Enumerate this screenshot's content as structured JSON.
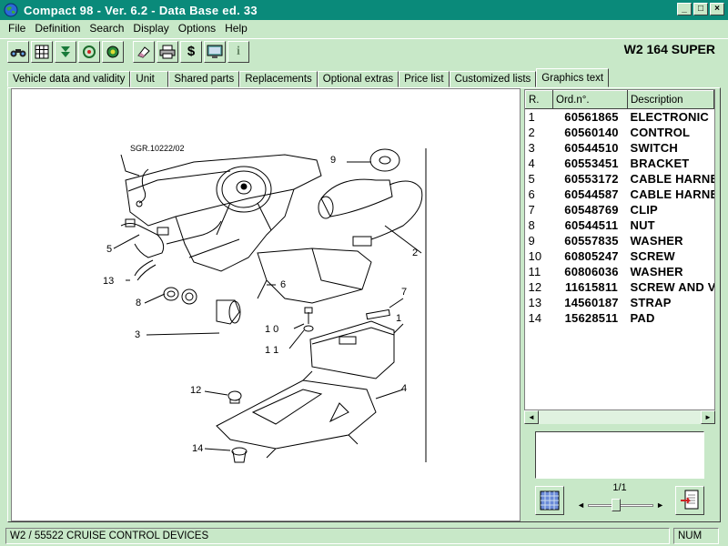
{
  "window": {
    "title": "Compact 98  -  Ver. 6.2  -  Data Base ed. 33",
    "minimize_glyph": "_",
    "maximize_glyph": "□",
    "close_glyph": "×"
  },
  "menu": [
    "File",
    "Definition",
    "Search",
    "Display",
    "Options",
    "Help"
  ],
  "toolbar": {
    "icons": [
      "binoculars-icon",
      "grid-icon",
      "down-arrow-icon",
      "steering-wheel-icon",
      "power-icon",
      "eraser-icon",
      "printer-icon",
      "dollar-icon",
      "monitor-icon",
      "info-icon"
    ],
    "dollar_glyph": "$",
    "info_glyph": "i"
  },
  "model": "W2 164 SUPER",
  "tabs": [
    {
      "label": "Vehicle data and validity",
      "active": false
    },
    {
      "label": "Unit",
      "active": false
    },
    {
      "label": "Shared parts",
      "active": false
    },
    {
      "label": "Replacements",
      "active": false
    },
    {
      "label": "Optional extras",
      "active": false
    },
    {
      "label": "Price list",
      "active": false
    },
    {
      "label": "Customized lists",
      "active": false
    },
    {
      "label": "Graphics text",
      "active": true
    }
  ],
  "drawing": {
    "ref_code": "SGR.10222/02",
    "callouts": [
      "1",
      "2",
      "3",
      "4",
      "5",
      "6",
      "7",
      "8",
      "9",
      "1 0",
      "1 1",
      "12",
      "13",
      "14"
    ]
  },
  "parts_table": {
    "headers": {
      "r": "R.",
      "ord": "Ord.n°.",
      "desc": "Description"
    },
    "rows": [
      {
        "r": "1",
        "ord": "60561865",
        "desc": "ELECTRONIC"
      },
      {
        "r": "2",
        "ord": "60560140",
        "desc": "CONTROL"
      },
      {
        "r": "3",
        "ord": "60544510",
        "desc": "SWITCH"
      },
      {
        "r": "4",
        "ord": "60553451",
        "desc": "BRACKET"
      },
      {
        "r": "5",
        "ord": "60553172",
        "desc": "CABLE HARNE"
      },
      {
        "r": "6",
        "ord": "60544587",
        "desc": "CABLE HARNE"
      },
      {
        "r": "7",
        "ord": "60548769",
        "desc": "CLIP"
      },
      {
        "r": "8",
        "ord": "60544511",
        "desc": "NUT"
      },
      {
        "r": "9",
        "ord": "60557835",
        "desc": "WASHER"
      },
      {
        "r": "10",
        "ord": "60805247",
        "desc": "SCREW"
      },
      {
        "r": "11",
        "ord": "60806036",
        "desc": "WASHER"
      },
      {
        "r": "12",
        "ord": "11615811",
        "desc": "SCREW AND V"
      },
      {
        "r": "13",
        "ord": "14560187",
        "desc": "STRAP"
      },
      {
        "r": "14",
        "ord": "15628511",
        "desc": "PAD"
      }
    ]
  },
  "pager": {
    "text": "1/1",
    "left_glyph": "◄",
    "right_glyph": "►",
    "scroll_left_glyph": "◄",
    "scroll_right_glyph": "►"
  },
  "status": {
    "left": "W2 / 55522  CRUISE CONTROL DEVICES",
    "num": "NUM"
  }
}
